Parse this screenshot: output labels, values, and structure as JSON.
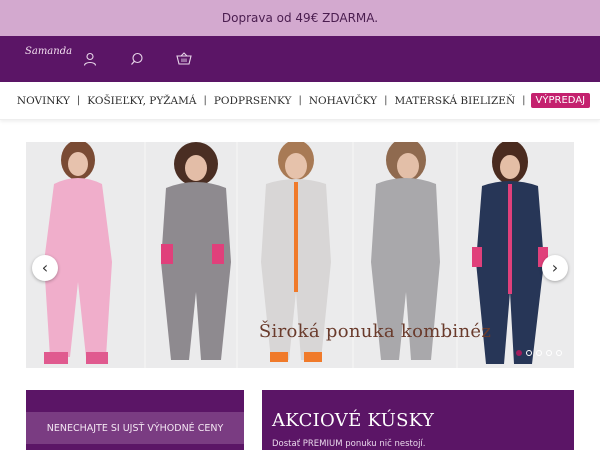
{
  "promo": {
    "text": "Doprava od 49€ ZDARMA."
  },
  "header": {
    "logo": "Samanda",
    "icons": [
      "user-icon",
      "search-icon",
      "cart-icon"
    ]
  },
  "nav": {
    "items": [
      "NOVINKY",
      "KOŠIEĽKY, PYŽAMÁ",
      "PODPRSENKY",
      "NOHAVIČKY",
      "MATERSKÁ BIELIZEŇ"
    ],
    "separator": "|",
    "sale_label": "VÝPREDAJ"
  },
  "hero": {
    "caption": "Široká ponuka kombinéz",
    "prev_arrow": "‹",
    "next_arrow": "›",
    "slide_count": 5,
    "active_slide": 1
  },
  "left_card": {
    "button_label": "NENECHAJTE SI UJSŤ VÝHODNÉ CENY"
  },
  "right_card": {
    "title": "AKCIOVÉ KÚSKY",
    "subtitle": "Dostať PREMIUM ponuku nič nestojí."
  },
  "colors": {
    "promo_bg": "#d3a9cf",
    "brand_purple": "#5b1566",
    "sale_pink": "#c4216e",
    "button_purple": "#7a3c82"
  }
}
